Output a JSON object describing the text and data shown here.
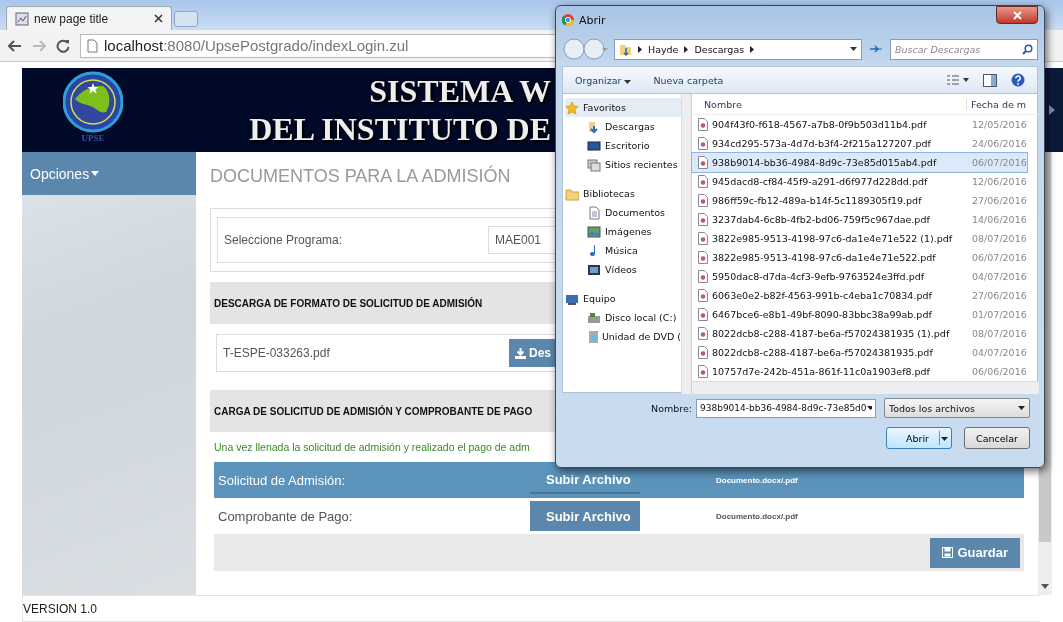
{
  "browser": {
    "tab_title": "new page title",
    "url_host": "localhost",
    "url_path": ":8080/UpsePostgrado/indexLogin.zul"
  },
  "header": {
    "logo_caption": "UPSE",
    "title_line_1": "SISTEMA W",
    "title_line_2": "DEL INSTITUTO DE"
  },
  "sidebar": {
    "menu_label": "Opciones"
  },
  "page_title": "DOCUMENTOS PARA LA ADMISIÓN",
  "program": {
    "label": "Seleccione Programa:",
    "value": "MAE001"
  },
  "download_section": {
    "heading": "DESCARGA DE FORMATO DE SOLICITUD DE ADMISIÓN",
    "file_name": "T-ESPE-033263.pdf",
    "button": "Des"
  },
  "upload_section": {
    "heading": "CARGA DE SOLICITUD DE ADMISIÓN Y COMPROBANTE DE PAGO",
    "note": "Una vez llenada la solicitud de admisión y realizado el pago de adm",
    "rows": [
      {
        "label": "Solicitud de Admisión:",
        "button": "Subir Archivo",
        "hint": "Documento.docx/.pdf",
        "highlighted": true
      },
      {
        "label": "Comprobante de Pago:",
        "button": "Subir Archivo",
        "hint": "Documento.docx/.pdf",
        "highlighted": false
      }
    ],
    "save_button": "Guardar"
  },
  "footer": "VERSION 1.0",
  "dialog": {
    "title": "Abrir",
    "breadcrumb": [
      "Hayde",
      "Descargas"
    ],
    "search_placeholder": "Buscar Descargas",
    "organize": "Organizar",
    "new_folder": "Nueva carpeta",
    "nav": [
      {
        "label": "Favoritos",
        "selected": true,
        "children": [
          {
            "label": "Descargas",
            "selected": false
          },
          {
            "label": "Escritorio",
            "selected": false
          },
          {
            "label": "Sitios recientes",
            "selected": false
          }
        ]
      },
      {
        "label": "Bibliotecas",
        "selected": false,
        "children": [
          {
            "label": "Documentos",
            "selected": false
          },
          {
            "label": "Imágenes",
            "selected": false
          },
          {
            "label": "Música",
            "selected": false
          },
          {
            "label": "Vídeos",
            "selected": false
          }
        ]
      },
      {
        "label": "Equipo",
        "selected": false,
        "children": [
          {
            "label": "Disco local (C:)",
            "selected": false
          },
          {
            "label": "Unidad de DVD (",
            "selected": false
          }
        ]
      }
    ],
    "columns": [
      "Nombre",
      "Fecha de m"
    ],
    "files": [
      {
        "name": "904f43f0-f618-4567-a7b8-0f9b503d11b4.pdf",
        "date": "12/05/2016",
        "selected": false
      },
      {
        "name": "934cd295-573a-4d7d-b3f4-2f215a127207.pdf",
        "date": "24/06/2016",
        "selected": false
      },
      {
        "name": "938b9014-bb36-4984-8d9c-73e85d015ab4.pdf",
        "date": "06/07/2016",
        "selected": true
      },
      {
        "name": "945dacd8-cf84-45f9-a291-d6f977d228dd.pdf",
        "date": "12/06/2016",
        "selected": false
      },
      {
        "name": "986ff59c-fb12-489a-b14f-5c1189305f19.pdf",
        "date": "27/06/2016",
        "selected": false
      },
      {
        "name": "3237dab4-6c8b-4fb2-bd06-759f5c967dae.pdf",
        "date": "14/06/2016",
        "selected": false
      },
      {
        "name": "3822e985-9513-4198-97c6-da1e4e71e522 (1).pdf",
        "date": "08/07/2016",
        "selected": false
      },
      {
        "name": "3822e985-9513-4198-97c6-da1e4e71e522.pdf",
        "date": "06/07/2016",
        "selected": false
      },
      {
        "name": "5950dac8-d7da-4cf3-9efb-9763524e3ffd.pdf",
        "date": "04/07/2016",
        "selected": false
      },
      {
        "name": "6063e0e2-b82f-4563-991b-c4eba1c70834.pdf",
        "date": "27/06/2016",
        "selected": false
      },
      {
        "name": "6467bce6-e8b1-49bf-8090-83bbc38a99ab.pdf",
        "date": "01/07/2016",
        "selected": false
      },
      {
        "name": "8022dcb8-c288-4187-be6a-f57024381935 (1).pdf",
        "date": "08/07/2016",
        "selected": false
      },
      {
        "name": "8022dcb8-c288-4187-be6a-f57024381935.pdf",
        "date": "04/07/2016",
        "selected": false
      },
      {
        "name": "10757d7e-242b-451a-861f-11c0a1903ef8.pdf",
        "date": "06/06/2016",
        "selected": false
      }
    ],
    "filename_label": "Nombre:",
    "filename_value": "938b9014-bb36-4984-8d9c-73e85d0",
    "file_type": "Todos los archivos",
    "open_button": "Abrir",
    "cancel_button": "Cancelar"
  }
}
